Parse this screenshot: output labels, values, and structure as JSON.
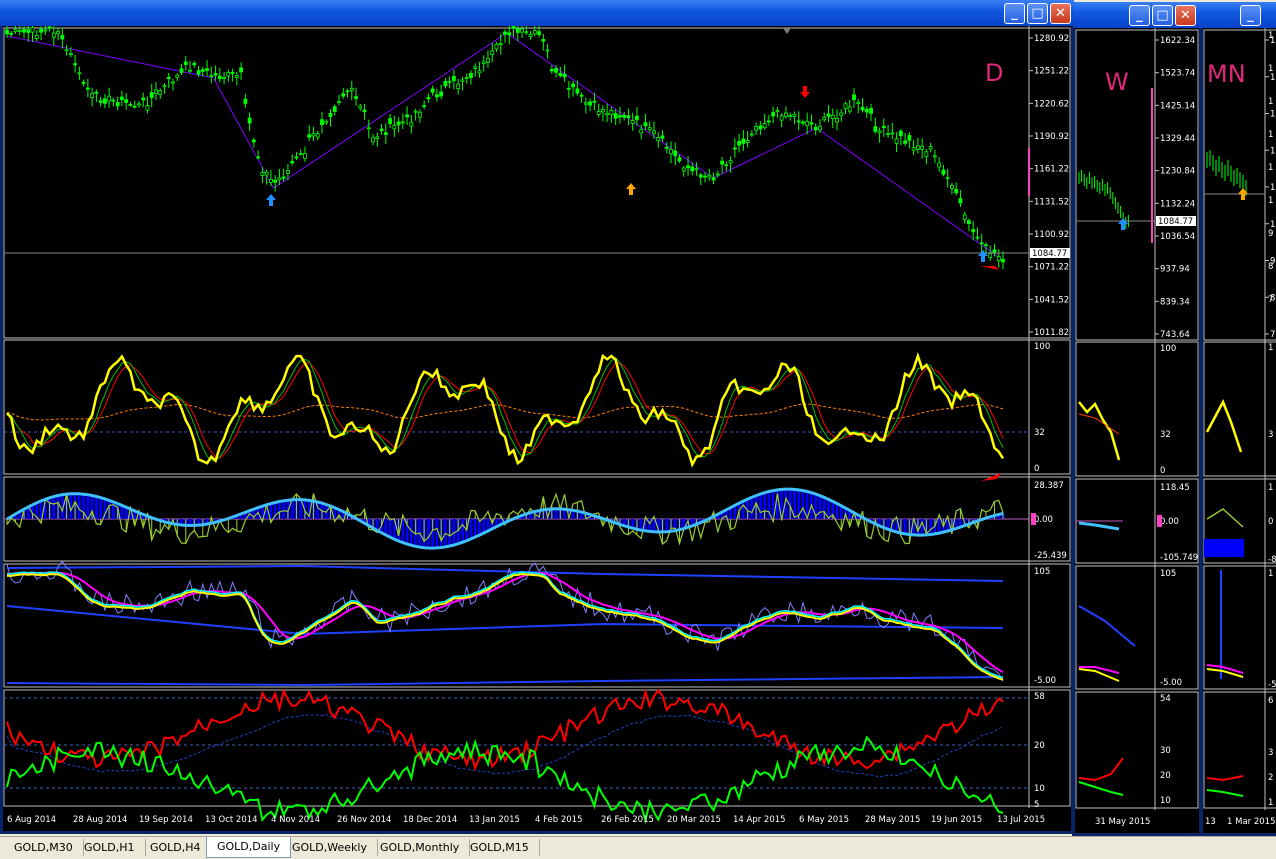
{
  "windows": {
    "daily": {
      "label": "D",
      "price_ticks": [
        "1280.92",
        "1251.22",
        "1220.62",
        "1190.92",
        "1161.22",
        "1131.52",
        "1100.92",
        "1071.22",
        "1041.52",
        "1011.82"
      ],
      "current_price": "1084.77",
      "osc_ticks": [
        "100",
        "32",
        "0"
      ],
      "macd_ticks": [
        "28.387",
        "0.00",
        "-25.439"
      ],
      "stoch_ticks": [
        "105",
        "-5.00"
      ],
      "adx_ticks": [
        "58",
        "20",
        "10",
        "5"
      ],
      "dates": [
        "6 Aug 2014",
        "28 Aug 2014",
        "19 Sep 2014",
        "13 Oct 2014",
        "4 Nov 2014",
        "26 Nov 2014",
        "18 Dec 2014",
        "13 Jan 2015",
        "4 Feb 2015",
        "26 Feb 2015",
        "20 Mar 2015",
        "14 Apr 2015",
        "6 May 2015",
        "28 May 2015",
        "19 Jun 2015",
        "13 Jul 2015"
      ]
    },
    "weekly": {
      "label": "W",
      "price_ticks": [
        "1622.34",
        "1523.74",
        "1425.14",
        "1329.44",
        "1230.84",
        "1132.24",
        "1036.54",
        "937.94",
        "839.34",
        "743.64"
      ],
      "current_price": "1084.77",
      "osc_ticks": [
        "100",
        "32",
        "0"
      ],
      "macd_ticks": [
        "118.45",
        "0.00",
        "-105.749"
      ],
      "stoch_ticks": [
        "105",
        "-5.00"
      ],
      "adx_ticks": [
        "54",
        "30",
        "20",
        "10"
      ],
      "dates": [
        "31 May 2015"
      ]
    },
    "monthly": {
      "label": "MN",
      "price_ticks": [
        "1",
        "1",
        "1",
        "1",
        "1",
        "1",
        "9",
        "8",
        "7"
      ],
      "osc_ticks": [
        "1",
        "3"
      ],
      "macd_ticks": [
        "1",
        "0",
        "-8"
      ],
      "stoch_ticks": [
        "1",
        "-5"
      ],
      "adx_ticks": [
        "6",
        "3",
        "2",
        "1"
      ],
      "dates": [
        "13",
        "1 Mar 2015"
      ]
    }
  },
  "tabs": [
    {
      "label": "GOLD,M30",
      "active": false
    },
    {
      "label": "GOLD,H1",
      "active": false
    },
    {
      "label": "GOLD,H4",
      "active": false
    },
    {
      "label": "GOLD,Daily",
      "active": true
    },
    {
      "label": "GOLD,Weekly",
      "active": false
    },
    {
      "label": "GOLD,Monthly",
      "active": false
    },
    {
      "label": "GOLD,M15",
      "active": false
    }
  ],
  "colors": {
    "candles": "#00ff00",
    "osc_main": "#ffff00",
    "label": "#e0287a",
    "arrow_up": "#1e90ff",
    "arrow_orange": "#ffa500",
    "arrow_red": "#ff0000",
    "macd_hist": "#0000ff",
    "adx_plus": "#00ff00",
    "adx_minus": "#ff0000"
  }
}
